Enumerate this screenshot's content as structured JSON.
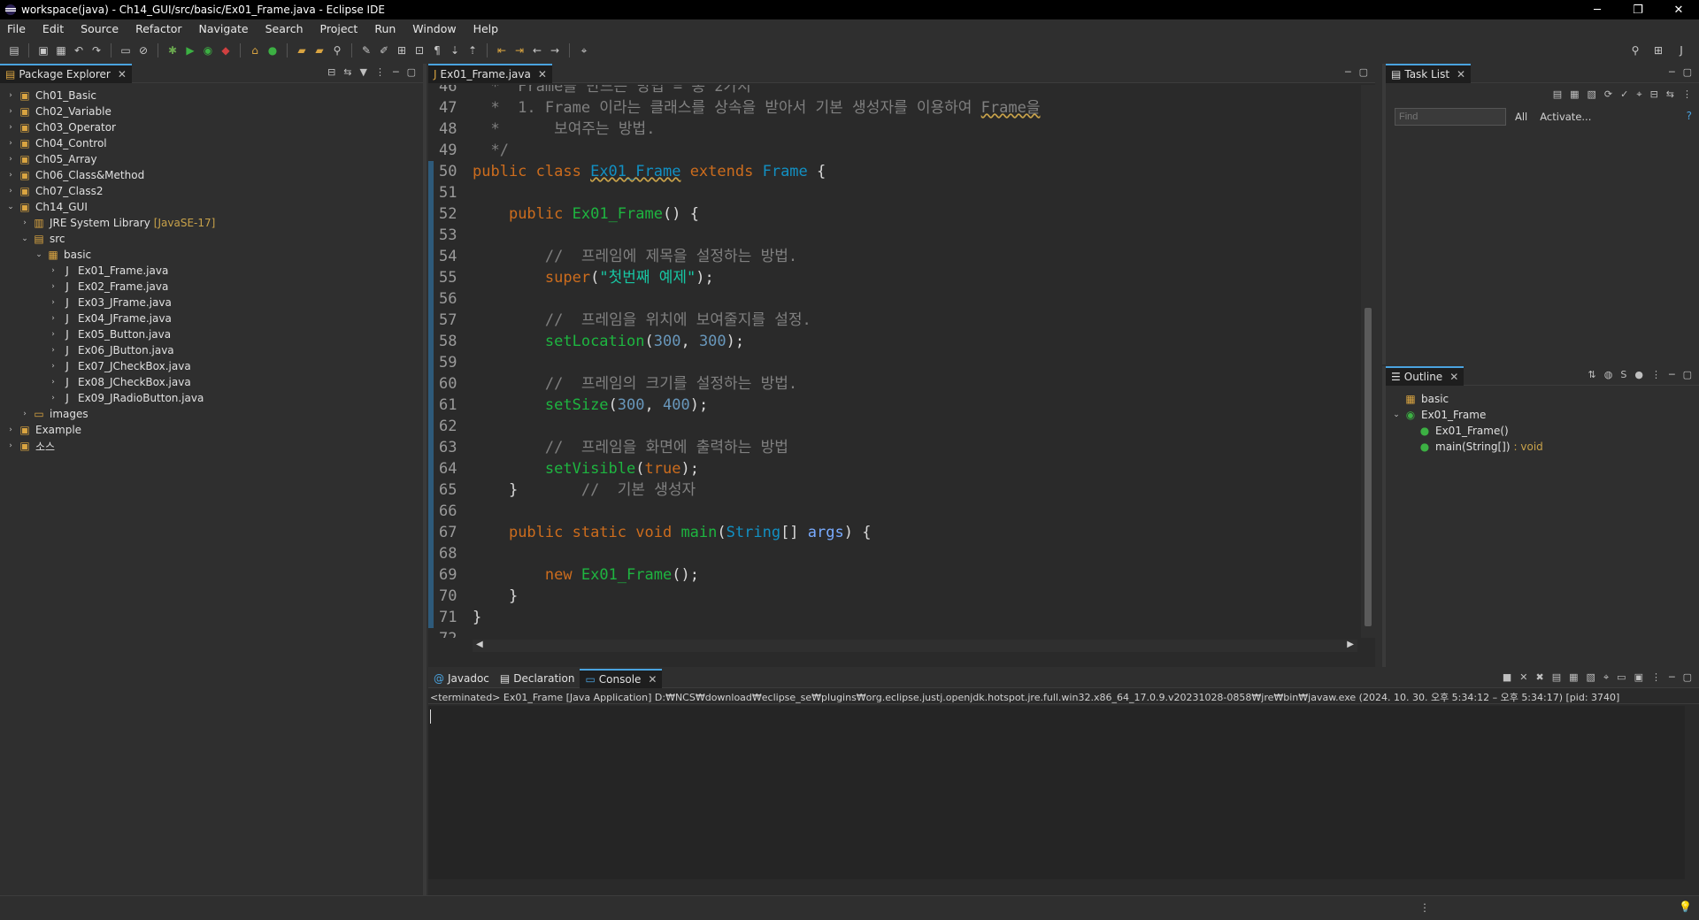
{
  "window": {
    "title": "workspace(java) - Ch14_GUI/src/basic/Ex01_Frame.java - Eclipse IDE",
    "minimize": "─",
    "restore": "❐",
    "close": "✕"
  },
  "menu": [
    "File",
    "Edit",
    "Source",
    "Refactor",
    "Navigate",
    "Search",
    "Project",
    "Run",
    "Window",
    "Help"
  ],
  "package_explorer": {
    "title": "Package Explorer",
    "items": [
      {
        "label": "Ch01_Basic",
        "depth": 0,
        "twisty": "›",
        "icon": "project-icon"
      },
      {
        "label": "Ch02_Variable",
        "depth": 0,
        "twisty": "›",
        "icon": "project-icon"
      },
      {
        "label": "Ch03_Operator",
        "depth": 0,
        "twisty": "›",
        "icon": "project-icon"
      },
      {
        "label": "Ch04_Control",
        "depth": 0,
        "twisty": "›",
        "icon": "project-icon"
      },
      {
        "label": "Ch05_Array",
        "depth": 0,
        "twisty": "›",
        "icon": "project-icon"
      },
      {
        "label": "Ch06_Class&Method",
        "depth": 0,
        "twisty": "›",
        "icon": "project-icon"
      },
      {
        "label": "Ch07_Class2",
        "depth": 0,
        "twisty": "›",
        "icon": "project-icon"
      },
      {
        "label": "Ch14_GUI",
        "depth": 0,
        "twisty": "⌄",
        "icon": "project-icon"
      },
      {
        "label": "JRE System Library",
        "extra": "[JavaSE-17]",
        "depth": 1,
        "twisty": "›",
        "icon": "library-icon"
      },
      {
        "label": "src",
        "depth": 1,
        "twisty": "⌄",
        "icon": "source-folder-icon"
      },
      {
        "label": "basic",
        "depth": 2,
        "twisty": "⌄",
        "icon": "package-icon"
      },
      {
        "label": "Ex01_Frame.java",
        "depth": 3,
        "twisty": "›",
        "icon": "java-file-icon"
      },
      {
        "label": "Ex02_Frame.java",
        "depth": 3,
        "twisty": "›",
        "icon": "java-file-icon"
      },
      {
        "label": "Ex03_JFrame.java",
        "depth": 3,
        "twisty": "›",
        "icon": "java-file-icon"
      },
      {
        "label": "Ex04_JFrame.java",
        "depth": 3,
        "twisty": "›",
        "icon": "java-file-icon"
      },
      {
        "label": "Ex05_Button.java",
        "depth": 3,
        "twisty": "›",
        "icon": "java-file-icon"
      },
      {
        "label": "Ex06_JButton.java",
        "depth": 3,
        "twisty": "›",
        "icon": "java-file-icon"
      },
      {
        "label": "Ex07_JCheckBox.java",
        "depth": 3,
        "twisty": "›",
        "icon": "java-file-icon"
      },
      {
        "label": "Ex08_JCheckBox.java",
        "depth": 3,
        "twisty": "›",
        "icon": "java-file-icon"
      },
      {
        "label": "Ex09_JRadioButton.java",
        "depth": 3,
        "twisty": "›",
        "icon": "java-file-icon"
      },
      {
        "label": "images",
        "depth": 1,
        "twisty": "›",
        "icon": "folder-icon"
      },
      {
        "label": "Example",
        "depth": 0,
        "twisty": "›",
        "icon": "project-icon"
      },
      {
        "label": "소스",
        "depth": 0,
        "twisty": "›",
        "icon": "project-icon"
      }
    ]
  },
  "editor": {
    "tab_label": "Ex01_Frame.java",
    "line_numbers": [
      "46",
      "47",
      "48",
      "49",
      "50",
      "51",
      "52",
      "53",
      "54",
      "55",
      "56",
      "57",
      "58",
      "59",
      "60",
      "61",
      "62",
      "63",
      "64",
      "65",
      "66",
      "67",
      "68",
      "69",
      "70",
      "71",
      "72"
    ]
  },
  "task_list": {
    "title": "Task List",
    "find_placeholder": "Find",
    "all_label": "All",
    "activate_label": "Activate..."
  },
  "outline": {
    "title": "Outline",
    "items": [
      {
        "label": "basic",
        "depth": 0
      },
      {
        "label": "Ex01_Frame",
        "depth": 0
      },
      {
        "label": "Ex01_Frame()",
        "depth": 1
      },
      {
        "label": "main(String[])",
        "type": " : void",
        "depth": 1
      }
    ]
  },
  "bottom": {
    "tabs": [
      "Javadoc",
      "Declaration",
      "Console"
    ],
    "active_tab": "Console",
    "console_status": "<terminated> Ex01_Frame [Java Application] D:₩NCS₩download₩eclipse_se₩plugins₩org.eclipse.justj.openjdk.hotspot.jre.full.win32.x86_64_17.0.9.v20231028-0858₩jre₩bin₩javaw.exe  (2024. 10. 30. 오후 5:34:12 – 오후 5:34:17) [pid: 3740]"
  },
  "colors": {
    "keyword": "#cc6c1d",
    "class": "#1290c3",
    "method": "#1eb540",
    "comment": "#808080",
    "string": "#17c6a3",
    "number": "#6897bb"
  }
}
